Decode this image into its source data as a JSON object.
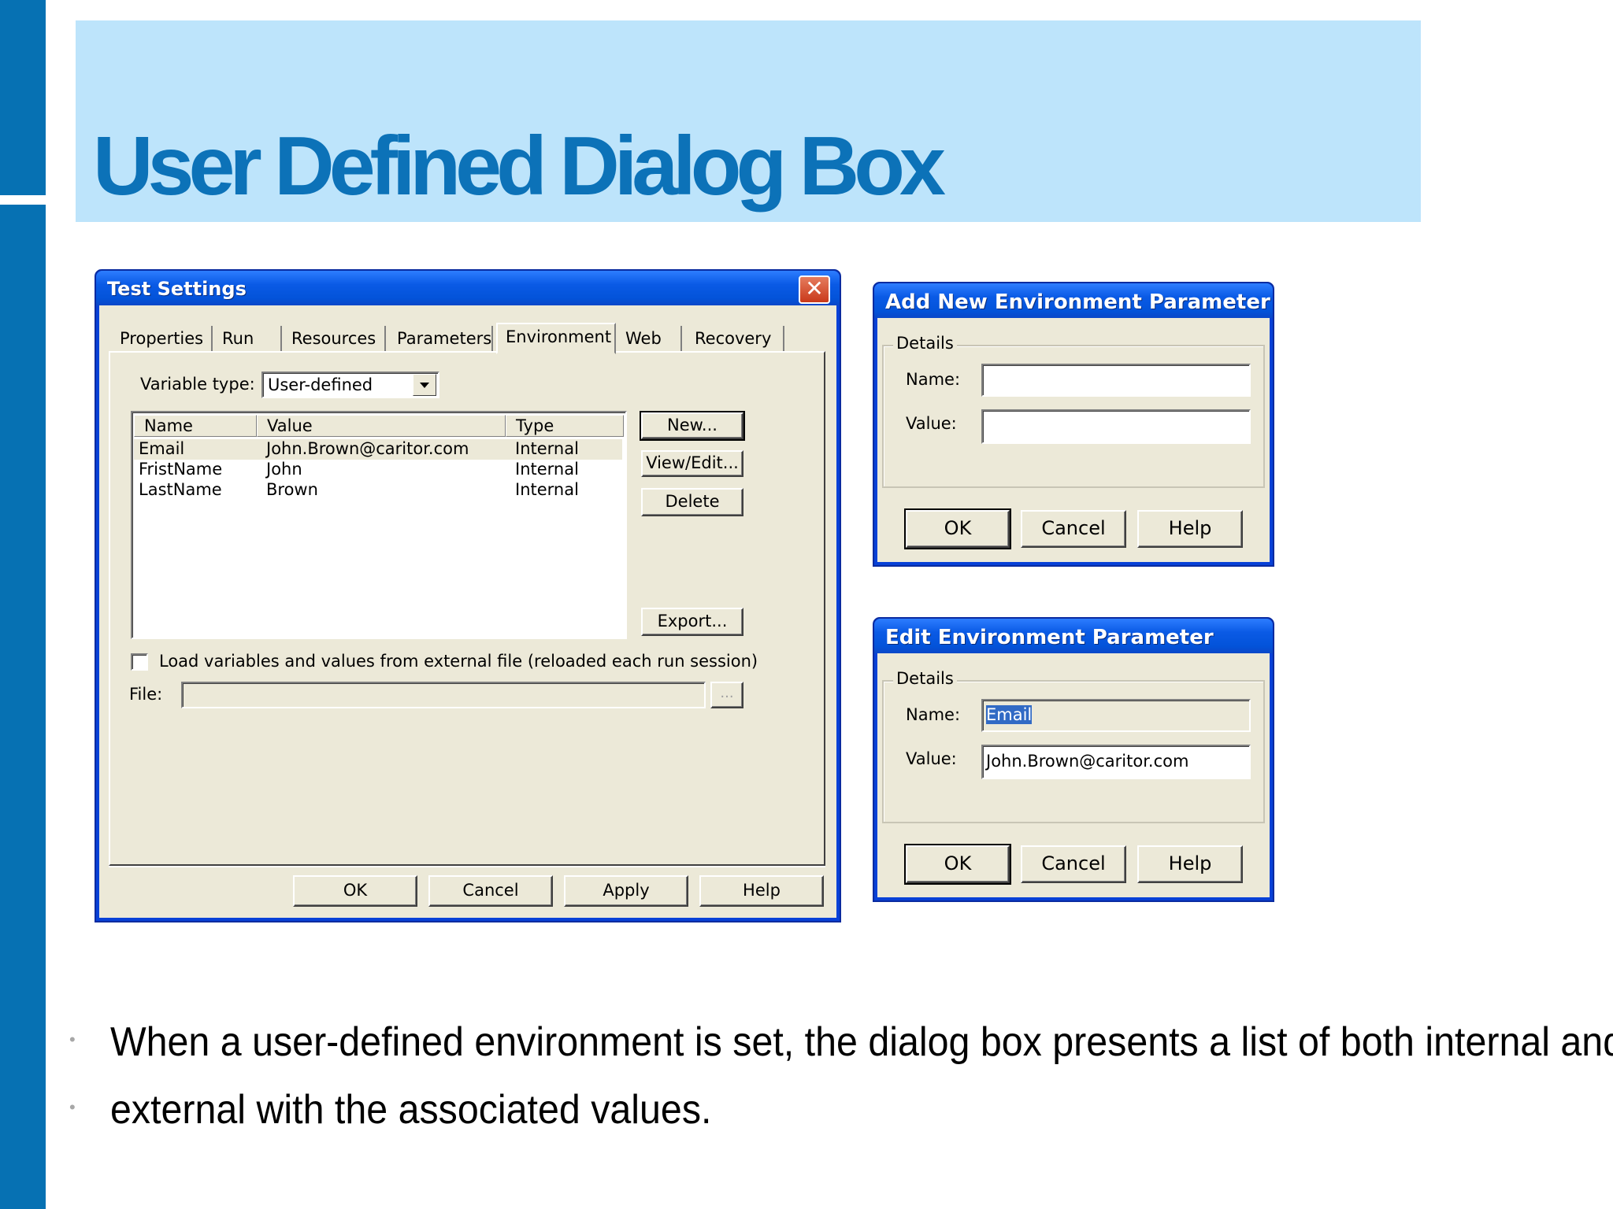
{
  "slide": {
    "title": "User Defined Dialog Box",
    "bullets": [
      "When a user-defined environment is set, the dialog box presents a list of both internal and",
      "external with the associated values."
    ],
    "colors": {
      "sidebar": "#0671b3",
      "title_band": "#bde4fb",
      "title_text": "#0c72b8"
    }
  },
  "test_settings": {
    "title": "Test Settings",
    "close_glyph": "✕",
    "tabs": [
      "Properties",
      "Run",
      "Resources",
      "Parameters",
      "Environment",
      "Web",
      "Recovery"
    ],
    "active_tab": "Environment",
    "variable_type_label": "Variable type:",
    "variable_type_value": "User-defined",
    "columns": [
      "Name",
      "Value",
      "Type"
    ],
    "rows": [
      {
        "name": "Email",
        "value": "John.Brown@caritor.com",
        "type": "Internal"
      },
      {
        "name": "FristName",
        "value": "John",
        "type": "Internal"
      },
      {
        "name": "LastName",
        "value": "Brown",
        "type": "Internal"
      }
    ],
    "new_button": "New...",
    "view_edit_button": "View/Edit...",
    "delete_button": "Delete",
    "export_button": "Export...",
    "load_checkbox_label": "Load variables and values from external file (reloaded each run session)",
    "load_checked": false,
    "file_label": "File:",
    "file_value": "",
    "browse_button": "...",
    "ok": "OK",
    "cancel": "Cancel",
    "apply": "Apply",
    "help": "Help"
  },
  "add_dialog": {
    "title": "Add New Environment Parameter",
    "group": "Details",
    "name_label": "Name:",
    "name_value": "",
    "value_label": "Value:",
    "value_value": "",
    "ok": "OK",
    "cancel": "Cancel",
    "help": "Help"
  },
  "edit_dialog": {
    "title": "Edit Environment Parameter",
    "group": "Details",
    "name_label": "Name:",
    "name_value": "Email",
    "value_label": "Value:",
    "value_value": "John.Brown@caritor.com",
    "ok": "OK",
    "cancel": "Cancel",
    "help": "Help"
  }
}
